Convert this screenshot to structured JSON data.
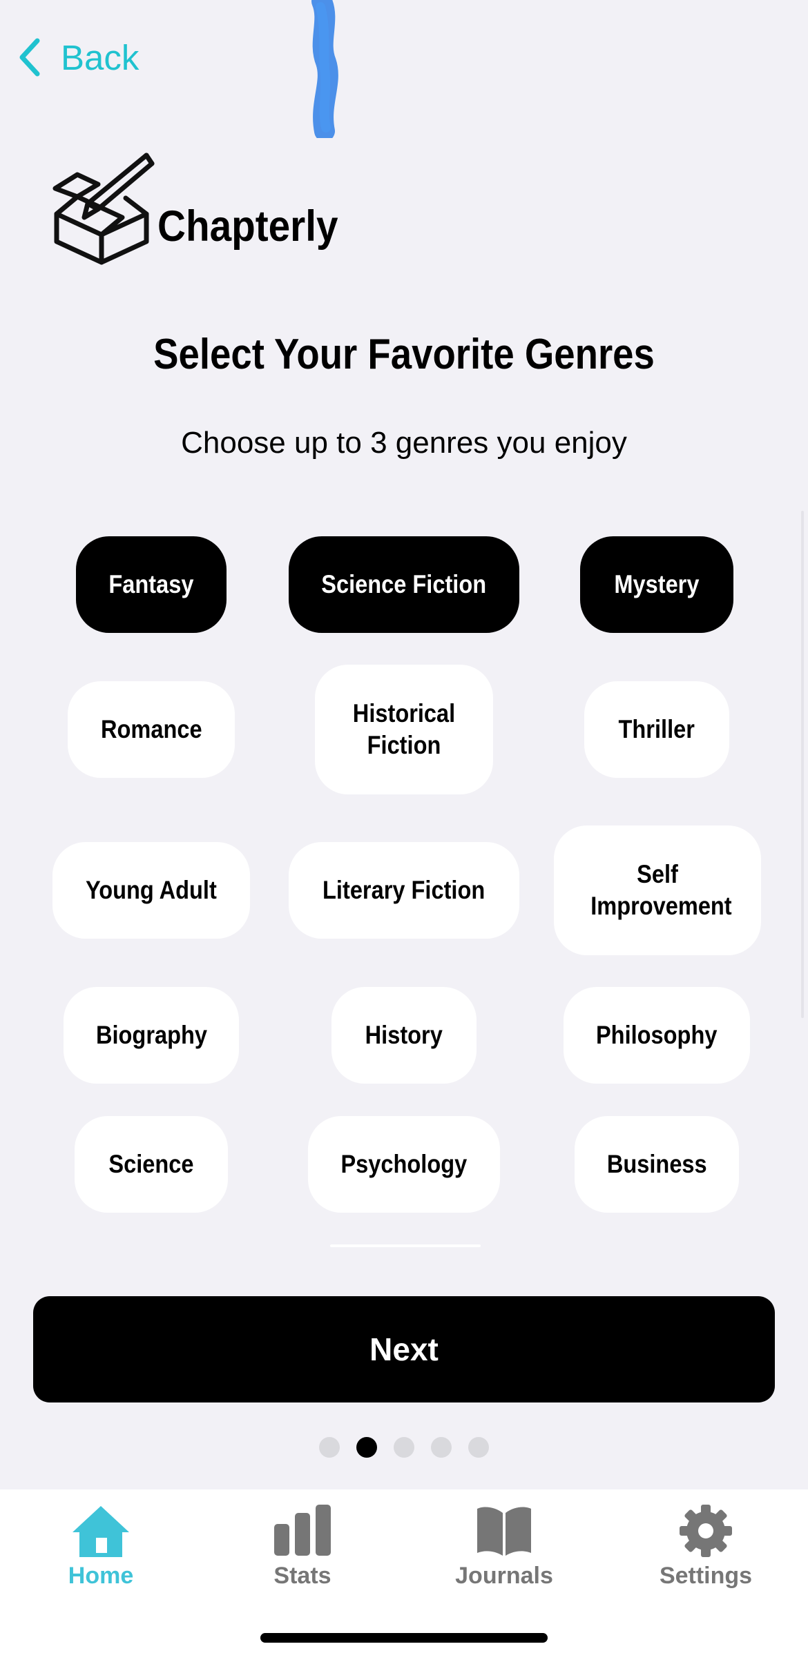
{
  "header": {
    "back_label": "Back"
  },
  "brand": {
    "name": "Chapterly"
  },
  "title": "Select Your Favorite Genres",
  "subtitle": "Choose up to 3 genres you enjoy",
  "genres": [
    {
      "label": "Fantasy",
      "selected": true
    },
    {
      "label": "Science Fiction",
      "selected": true
    },
    {
      "label": "Mystery",
      "selected": true
    },
    {
      "label": "Romance",
      "selected": false
    },
    {
      "label": "Historical Fiction",
      "selected": false
    },
    {
      "label": "Thriller",
      "selected": false
    },
    {
      "label": "Young Adult",
      "selected": false
    },
    {
      "label": "Literary Fiction",
      "selected": false
    },
    {
      "label": "Self Improvement",
      "selected": false
    },
    {
      "label": "Biography",
      "selected": false
    },
    {
      "label": "History",
      "selected": false
    },
    {
      "label": "Philosophy",
      "selected": false
    },
    {
      "label": "Science",
      "selected": false
    },
    {
      "label": "Psychology",
      "selected": false
    },
    {
      "label": "Business",
      "selected": false
    }
  ],
  "next_label": "Next",
  "pagination": {
    "total": 5,
    "current": 2
  },
  "tabbar": {
    "items": [
      {
        "label": "Home",
        "icon": "home-icon",
        "active": true
      },
      {
        "label": "Stats",
        "icon": "stats-icon",
        "active": false
      },
      {
        "label": "Journals",
        "icon": "book-icon",
        "active": false
      },
      {
        "label": "Settings",
        "icon": "gear-icon",
        "active": false
      }
    ]
  },
  "colors": {
    "accent": "#20c2cf",
    "tab_active": "#3fc3d8",
    "background": "#f2f1f6",
    "chip_selected": "#000000",
    "chip_default": "#ffffff"
  }
}
